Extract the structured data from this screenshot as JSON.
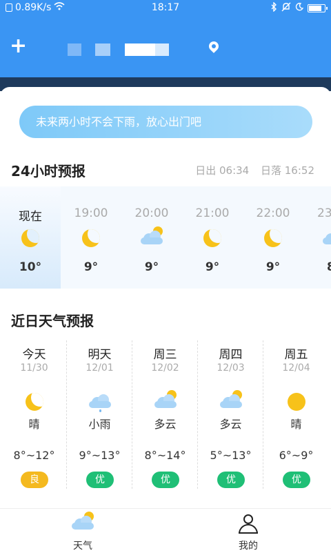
{
  "status": {
    "net_speed": "0.89K/s",
    "time": "18:17"
  },
  "colors": {
    "primary": "#3a95f3",
    "good": "#1fbf76",
    "moderate": "#f4b91f",
    "banner": "#7ec9f8"
  },
  "rain_banner": "未来两小时不会下雨，放心出门吧",
  "hourly": {
    "title": "24小时预报",
    "sunrise": "日出 06:34",
    "sunset": "日落 16:52",
    "items": [
      {
        "time": "现在",
        "icon": "moon-icon",
        "temp": "10°"
      },
      {
        "time": "19:00",
        "icon": "moon-icon",
        "temp": "9°"
      },
      {
        "time": "20:00",
        "icon": "cloudy-night-icon",
        "temp": "9°"
      },
      {
        "time": "21:00",
        "icon": "moon-icon",
        "temp": "9°"
      },
      {
        "time": "22:00",
        "icon": "moon-icon",
        "temp": "9°"
      },
      {
        "time": "23",
        "icon": "cloud-icon",
        "temp": "8"
      }
    ]
  },
  "daily": {
    "title": "近日天气预报",
    "items": [
      {
        "name": "今天",
        "date": "11/30",
        "icon": "moon-icon",
        "cond": "晴",
        "range": "8°~12°",
        "aqi": "良",
        "aqi_color": "#f4b91f"
      },
      {
        "name": "明天",
        "date": "12/01",
        "icon": "light-rain-icon",
        "cond": "小雨",
        "range": "9°~13°",
        "aqi": "优",
        "aqi_color": "#1fbf76"
      },
      {
        "name": "周三",
        "date": "12/02",
        "icon": "partly-cloudy-icon",
        "cond": "多云",
        "range": "8°~14°",
        "aqi": "优",
        "aqi_color": "#1fbf76"
      },
      {
        "name": "周四",
        "date": "12/03",
        "icon": "partly-cloudy-icon",
        "cond": "多云",
        "range": "5°~13°",
        "aqi": "优",
        "aqi_color": "#1fbf76"
      },
      {
        "name": "周五",
        "date": "12/04",
        "icon": "sun-icon",
        "cond": "晴",
        "range": "6°~9°",
        "aqi": "优",
        "aqi_color": "#1fbf76"
      }
    ]
  },
  "tabs": {
    "weather": "天气",
    "mine": "我的"
  }
}
